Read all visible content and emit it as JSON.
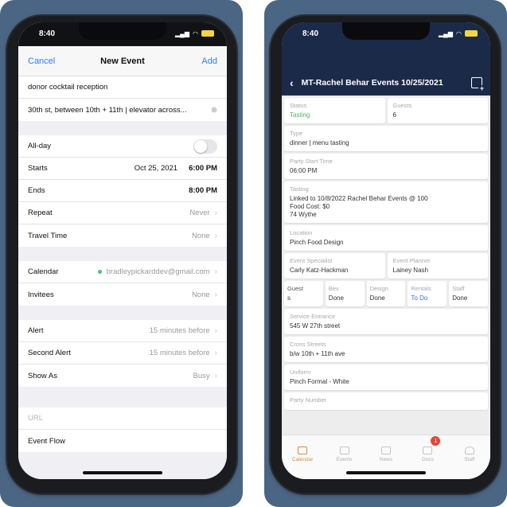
{
  "left": {
    "status": {
      "time": "8:40"
    },
    "nav": {
      "cancel": "Cancel",
      "title": "New Event",
      "add": "Add"
    },
    "title": "donor cocktail reception",
    "location": "30th st, between 10th + 11th | elevator across...",
    "allday": "All-day",
    "starts": {
      "label": "Starts",
      "date": "Oct 25, 2021",
      "time": "6:00 PM"
    },
    "ends": {
      "label": "Ends",
      "time": "8:00 PM"
    },
    "repeat": {
      "label": "Repeat",
      "value": "Never"
    },
    "travel": {
      "label": "Travel Time",
      "value": "None"
    },
    "calendar": {
      "label": "Calendar",
      "value": "bradleypickarddev@gmail.com"
    },
    "invitees": {
      "label": "Invitees",
      "value": "None"
    },
    "alert": {
      "label": "Alert",
      "value": "15 minutes before"
    },
    "second_alert": {
      "label": "Second Alert",
      "value": "15 minutes before"
    },
    "show_as": {
      "label": "Show As",
      "value": "Busy"
    },
    "url": "URL",
    "event_flow": "Event Flow"
  },
  "right": {
    "status": {
      "time": "8:40"
    },
    "header_title": "MT-Rachel Behar Events 10/25/2021",
    "status_card": {
      "label": "Status",
      "value": "Tasting"
    },
    "guests_card": {
      "label": "Guests",
      "value": "6"
    },
    "type_card": {
      "label": "Type",
      "value": "dinner | menu tasting"
    },
    "start_card": {
      "label": "Party Start Time",
      "value": "06:00 PM"
    },
    "tasting_card": {
      "label": "Tasting",
      "value": "Linked to 10/8/2022 Rachel Behar Events @ 100\nFood Cost: $0\n74 Wythe"
    },
    "location_card": {
      "label": "Location",
      "value": "Pinch Food Design"
    },
    "specialist_card": {
      "label": "Event Specialist",
      "value": "Carly Katz-Hackman"
    },
    "planner_card": {
      "label": "Event Planner",
      "value": "Lainey Nash"
    },
    "mini": [
      {
        "label": "Guest",
        "value": "s",
        "color": ""
      },
      {
        "label": "Bev",
        "value": "Done",
        "color": ""
      },
      {
        "label": "Design",
        "value": "Done",
        "color": ""
      },
      {
        "label": "Rentals",
        "value": "To Do",
        "color": "blue"
      },
      {
        "label": "Staff",
        "value": "Done",
        "color": ""
      }
    ],
    "service_card": {
      "label": "Service Entrance",
      "value": "545 W 27th street"
    },
    "cross_card": {
      "label": "Cross Streets",
      "value": "b/w 10th + 11th ave"
    },
    "uniform_card": {
      "label": "Uniform",
      "value": "Pinch Formal - White"
    },
    "party_number_card": {
      "label": "Party Number",
      "value": ""
    },
    "tabs": [
      {
        "label": "Calendar",
        "active": true
      },
      {
        "label": "Events",
        "active": false
      },
      {
        "label": "News",
        "active": false
      },
      {
        "label": "Docs",
        "active": false,
        "badge": "1"
      },
      {
        "label": "Staff",
        "active": false
      }
    ]
  }
}
